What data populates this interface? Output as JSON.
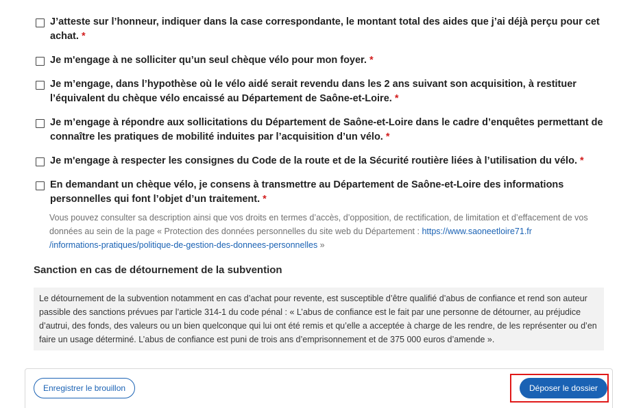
{
  "checkboxes": [
    {
      "label": "J’atteste sur l’honneur, indiquer dans la case correspondante, le montant total des aides que j’ai déjà perçu pour cet achat.",
      "required": "*",
      "checked": false
    },
    {
      "label": "Je m'engage à ne solliciter qu’un seul chèque vélo pour mon foyer.",
      "required": "*",
      "checked": false
    },
    {
      "label": "Je m’engage, dans l’hypothèse où le vélo aidé serait revendu dans les 2 ans suivant son acquisition, à restituer l’équivalent du chèque vélo encaissé au Département de Saône-et-Loire.",
      "required": "*",
      "checked": false
    },
    {
      "label": "Je m’engage à répondre aux sollicitations du Département de Saône-et-Loire dans le cadre d’enquêtes permettant de connaître les pratiques de mobilité induites par l’acquisition d’un vélo.",
      "required": "*",
      "checked": false
    },
    {
      "label": "Je m'engage à respecter les consignes du Code de la route et de la Sécurité routière liées à l’utilisation du vélo.",
      "required": "*",
      "checked": false
    },
    {
      "label": "En demandant un chèque vélo, je consens à transmettre au Département de Saône-et-Loire des informations personnelles qui font l’objet d’un traitement.",
      "required": "*",
      "checked": false
    }
  ],
  "privacy": {
    "text_before": "Vous pouvez consulter sa description ainsi que vos droits en termes d’accès, d’opposition, de rectification, de limitation et d’effacement de vos données au sein de la page « Protection des données personnelles du site web du Département : ",
    "link_line1": "https://www.saoneetloire71.fr",
    "link_line2": "/informations-pratiques/politique-de-gestion-des-donnees-personnelles",
    "text_after": " »"
  },
  "sanction": {
    "title": "Sanction en cas de détournement de la subvention",
    "text": "Le détournement de la subvention notamment en cas d’achat pour revente, est susceptible d’être qualifié d’abus de confiance et rend son auteur passible des sanctions prévues par l’article 314-1 du code pénal : « L’abus de confiance est le fait par une personne de détourner, au préjudice d’autrui, des fonds, des valeurs ou un bien quelconque qui lui ont été remis et qu’elle a acceptée à charge de les rendre, de les représenter ou d’en faire un usage déterminé. L’abus de confiance est puni de trois ans d’emprisonnement et de 375 000 euros d’amende »."
  },
  "footer": {
    "draft_label": "Enregistrer le brouillon",
    "submit_label": "Déposer le dossier"
  },
  "colors": {
    "accent": "#1a62b4",
    "required": "#d21e1e",
    "highlight": "#e01818"
  }
}
